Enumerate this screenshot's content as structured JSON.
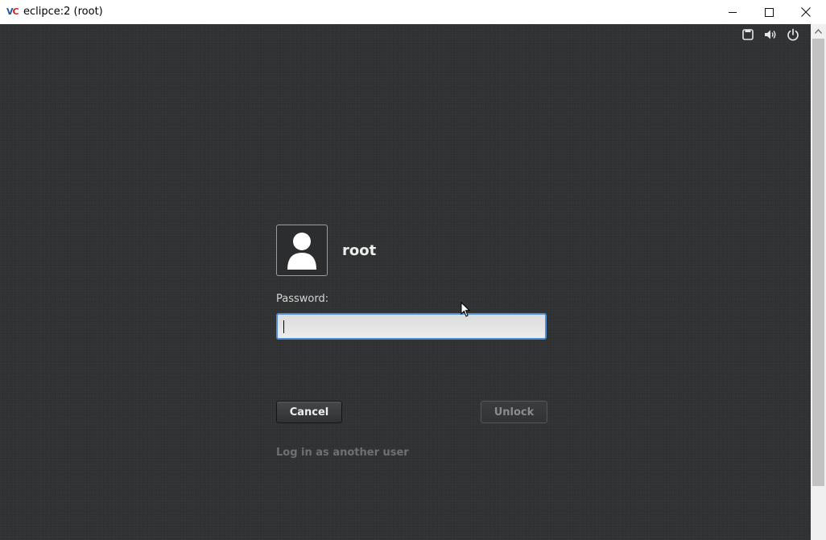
{
  "window": {
    "title": "eclipce:2 (root)",
    "icon_left": "V",
    "icon_right": "C"
  },
  "system_tray": {
    "icons": [
      "screen-icon",
      "volume-icon",
      "power-icon"
    ]
  },
  "lock_screen": {
    "username": "root",
    "password_label": "Password:",
    "password_value": "",
    "cancel_label": "Cancel",
    "unlock_label": "Unlock",
    "other_user_link": "Log in as another user"
  },
  "colors": {
    "background": "#2f3133",
    "focus_ring": "#4a90d9",
    "text_primary": "#eeeeec",
    "text_dim": "#6e7072"
  }
}
